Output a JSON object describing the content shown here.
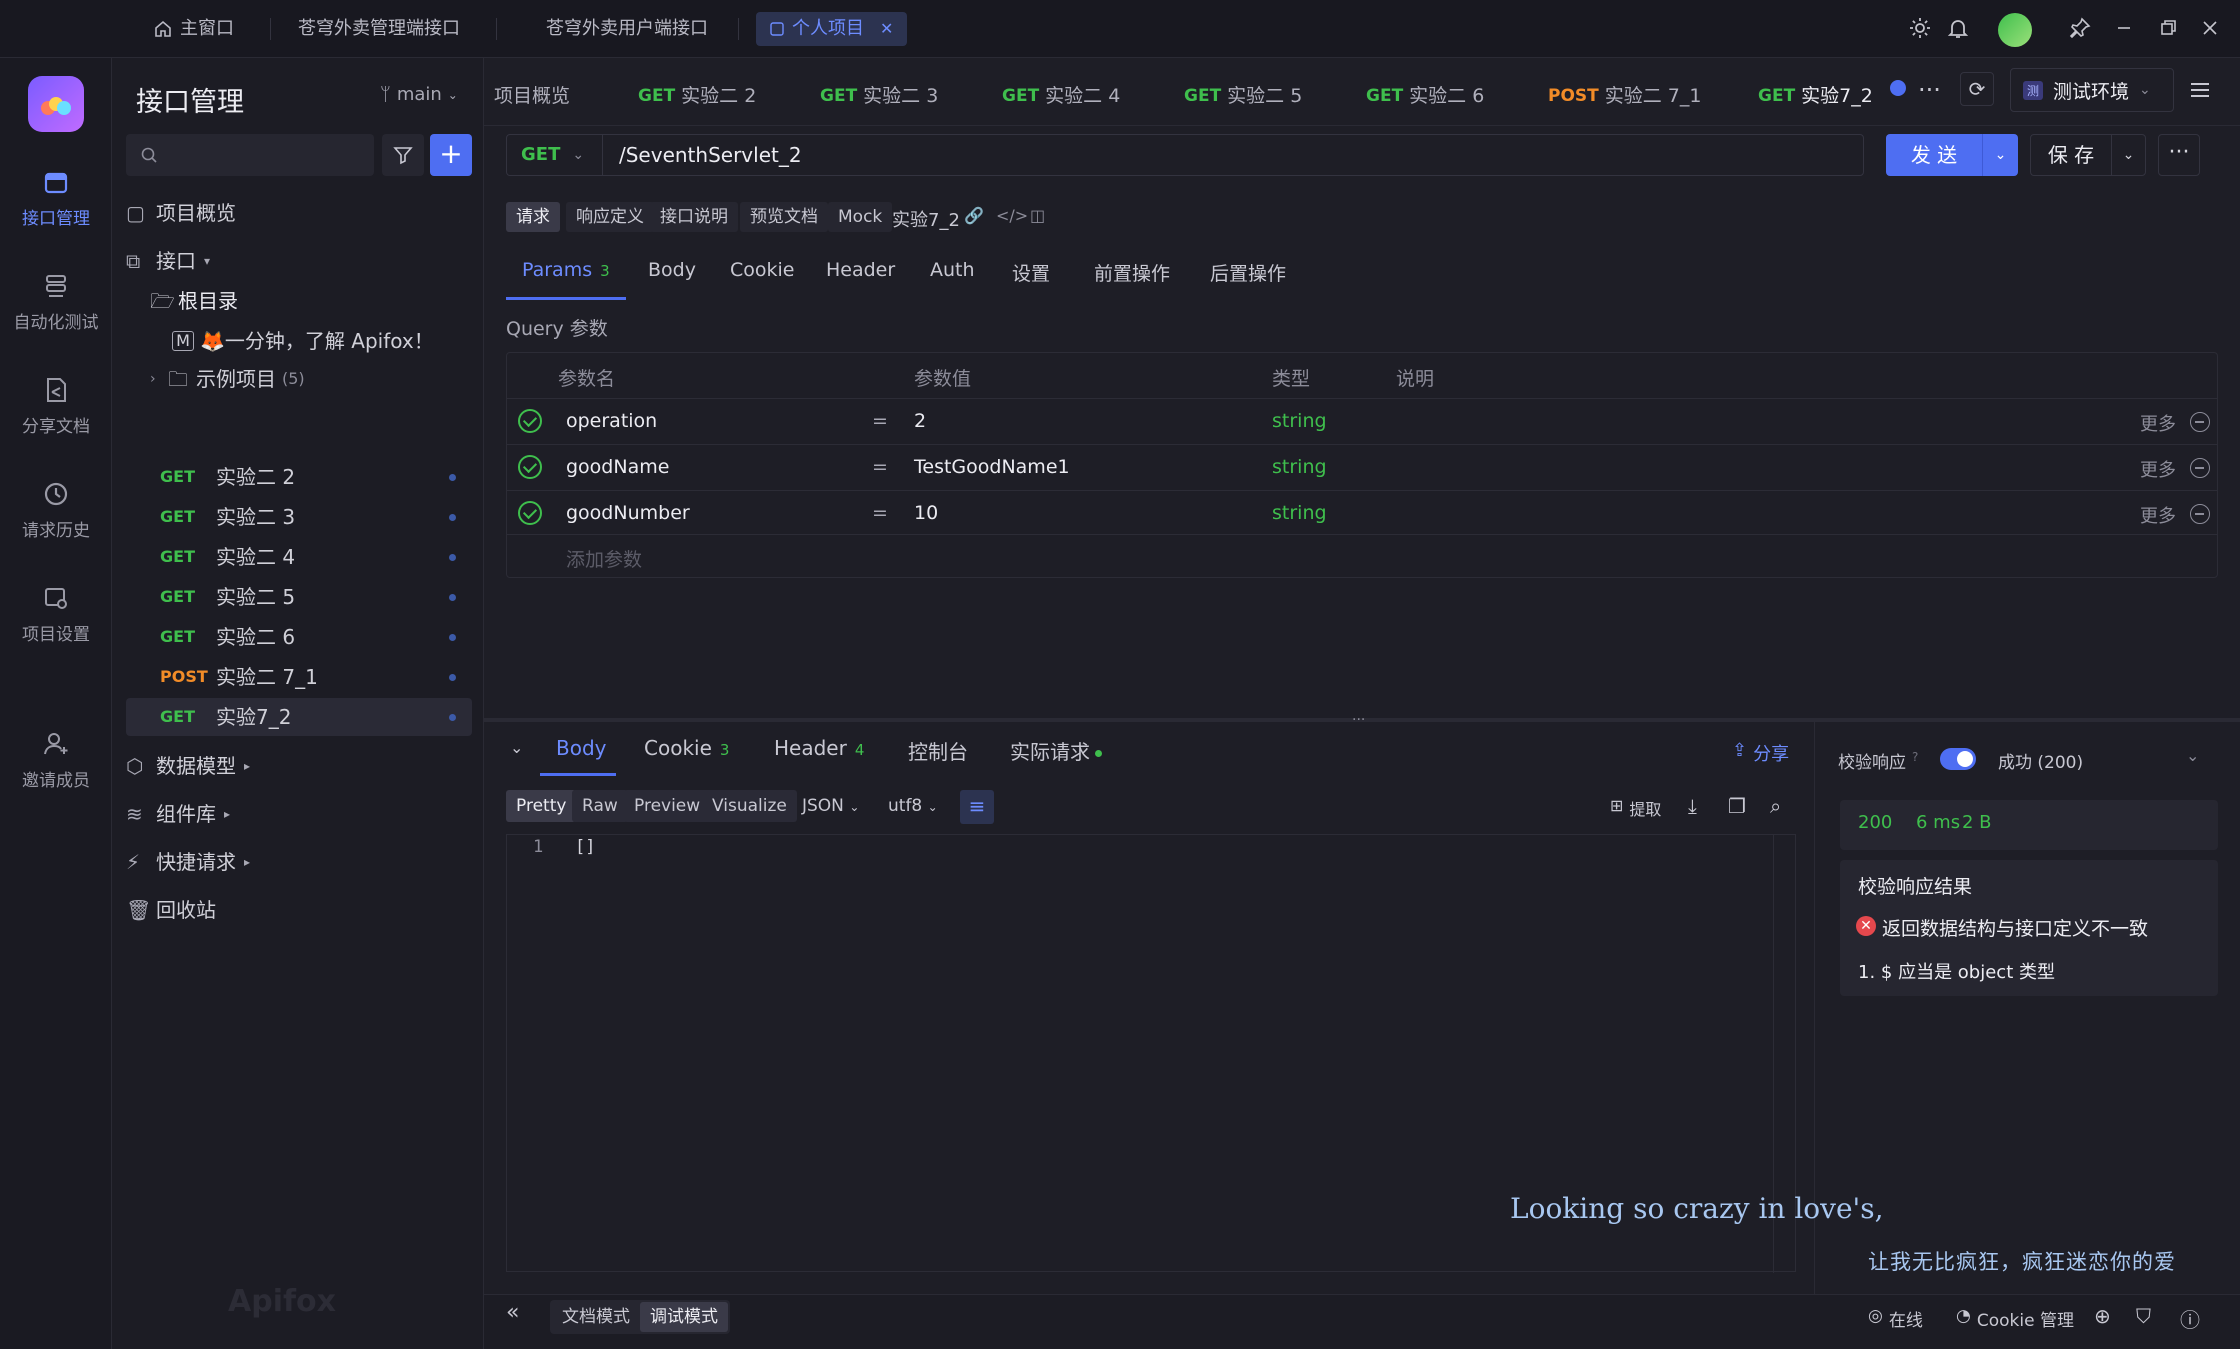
{
  "titlebar": {
    "tabs": [
      {
        "label": "主窗口",
        "icon": "home-icon"
      },
      {
        "label": "苍穹外卖管理端接口"
      },
      {
        "label": "苍穹外卖用户端接口"
      },
      {
        "label": "个人项目",
        "active": true
      }
    ]
  },
  "rail": {
    "items": [
      {
        "label": "接口管理",
        "icon": "api-icon",
        "active": true
      },
      {
        "label": "自动化测试",
        "icon": "automation-icon"
      },
      {
        "label": "分享文档",
        "icon": "share-doc-icon"
      },
      {
        "label": "请求历史",
        "icon": "history-icon"
      },
      {
        "label": "项目设置",
        "icon": "project-settings-icon"
      },
      {
        "label": "邀请成员",
        "icon": "invite-member-icon"
      }
    ]
  },
  "sidebar": {
    "title": "接口管理",
    "branch": "main",
    "search_placeholder": "",
    "overview": "项目概览",
    "interfaces": "接口",
    "root": "根目录",
    "intro_doc": "🦊一分钟，了解 Apifox！",
    "example_folder": "示例项目",
    "example_count": "(5)",
    "apis": [
      {
        "method": "GET",
        "name": "实验二 2"
      },
      {
        "method": "GET",
        "name": "实验二 3"
      },
      {
        "method": "GET",
        "name": "实验二 4"
      },
      {
        "method": "GET",
        "name": "实验二 5"
      },
      {
        "method": "GET",
        "name": "实验二 6"
      },
      {
        "method": "POST",
        "name": "实验二 7_1"
      },
      {
        "method": "GET",
        "name": "实验7_2",
        "selected": true
      }
    ],
    "data_model": "数据模型",
    "components": "组件库",
    "quick_request": "快捷请求",
    "recycle": "回收站",
    "watermark": "Apifox"
  },
  "request_tabs": [
    {
      "label": "项目概览"
    },
    {
      "method": "GET",
      "label": "实验二 2"
    },
    {
      "method": "GET",
      "label": "实验二 3"
    },
    {
      "method": "GET",
      "label": "实验二 4"
    },
    {
      "method": "GET",
      "label": "实验二 5"
    },
    {
      "method": "GET",
      "label": "实验二 6"
    },
    {
      "method": "POST",
      "label": "实验二 7_1"
    },
    {
      "method": "GET",
      "label": "实验7_2",
      "active": true
    }
  ],
  "environment": {
    "badge": "测",
    "label": "测试环境"
  },
  "request": {
    "method": "GET",
    "url": "/SeventhServlet_2",
    "send": "发 送",
    "save": "保 存"
  },
  "mode_tabs": [
    "请求",
    "响应定义",
    "接口说明",
    "预览文档",
    "Mock"
  ],
  "api_name": "实验7_2",
  "param_tabs": [
    {
      "label": "Params",
      "count": "3",
      "active": true
    },
    {
      "label": "Body"
    },
    {
      "label": "Cookie"
    },
    {
      "label": "Header"
    },
    {
      "label": "Auth"
    },
    {
      "label": "设置"
    },
    {
      "label": "前置操作"
    },
    {
      "label": "后置操作"
    }
  ],
  "query": {
    "section_title": "Query 参数",
    "headers": {
      "name": "参数名",
      "value": "参数值",
      "type": "类型",
      "desc": "说明"
    },
    "rows": [
      {
        "name": "operation",
        "eq": "=",
        "value": "2",
        "type": "string",
        "more": "更多"
      },
      {
        "name": "goodName",
        "eq": "=",
        "value": "TestGoodName1",
        "type": "string",
        "more": "更多"
      },
      {
        "name": "goodNumber",
        "eq": "=",
        "value": "10",
        "type": "string",
        "more": "更多"
      }
    ],
    "add_placeholder": "添加参数"
  },
  "response": {
    "tabs": [
      {
        "label": "Body",
        "active": true
      },
      {
        "label": "Cookie",
        "count": "3"
      },
      {
        "label": "Header",
        "count": "4"
      },
      {
        "label": "控制台"
      },
      {
        "label": "实际请求"
      }
    ],
    "share": "分享",
    "format_tabs": [
      "Pretty",
      "Raw",
      "Preview",
      "Visualize"
    ],
    "format": "JSON",
    "encoding": "utf8",
    "extract": "提取",
    "code_line_no": "1",
    "code_line": "[]",
    "validate_label": "校验响应",
    "status_select": "成功 (200)",
    "status_code": "200",
    "time": "6 ms",
    "size": "2 B",
    "validate_result_title": "校验响应结果",
    "validate_error": "返回数据结构与接口定义不一致",
    "validate_detail": "1. $ 应当是 object 类型"
  },
  "overlay": {
    "lyric_en": "Looking so crazy in love's,",
    "lyric_cn": "让我无比疯狂，疯狂迷恋你的爱"
  },
  "bottombar": {
    "doc_mode": "文档模式",
    "debug_mode": "调试模式",
    "online": "在线",
    "cookie_manage": "Cookie 管理"
  },
  "colors": {
    "accent": "#4e6ef2",
    "get": "#3fbf4d",
    "post": "#f28c28",
    "error": "#e5484d"
  }
}
